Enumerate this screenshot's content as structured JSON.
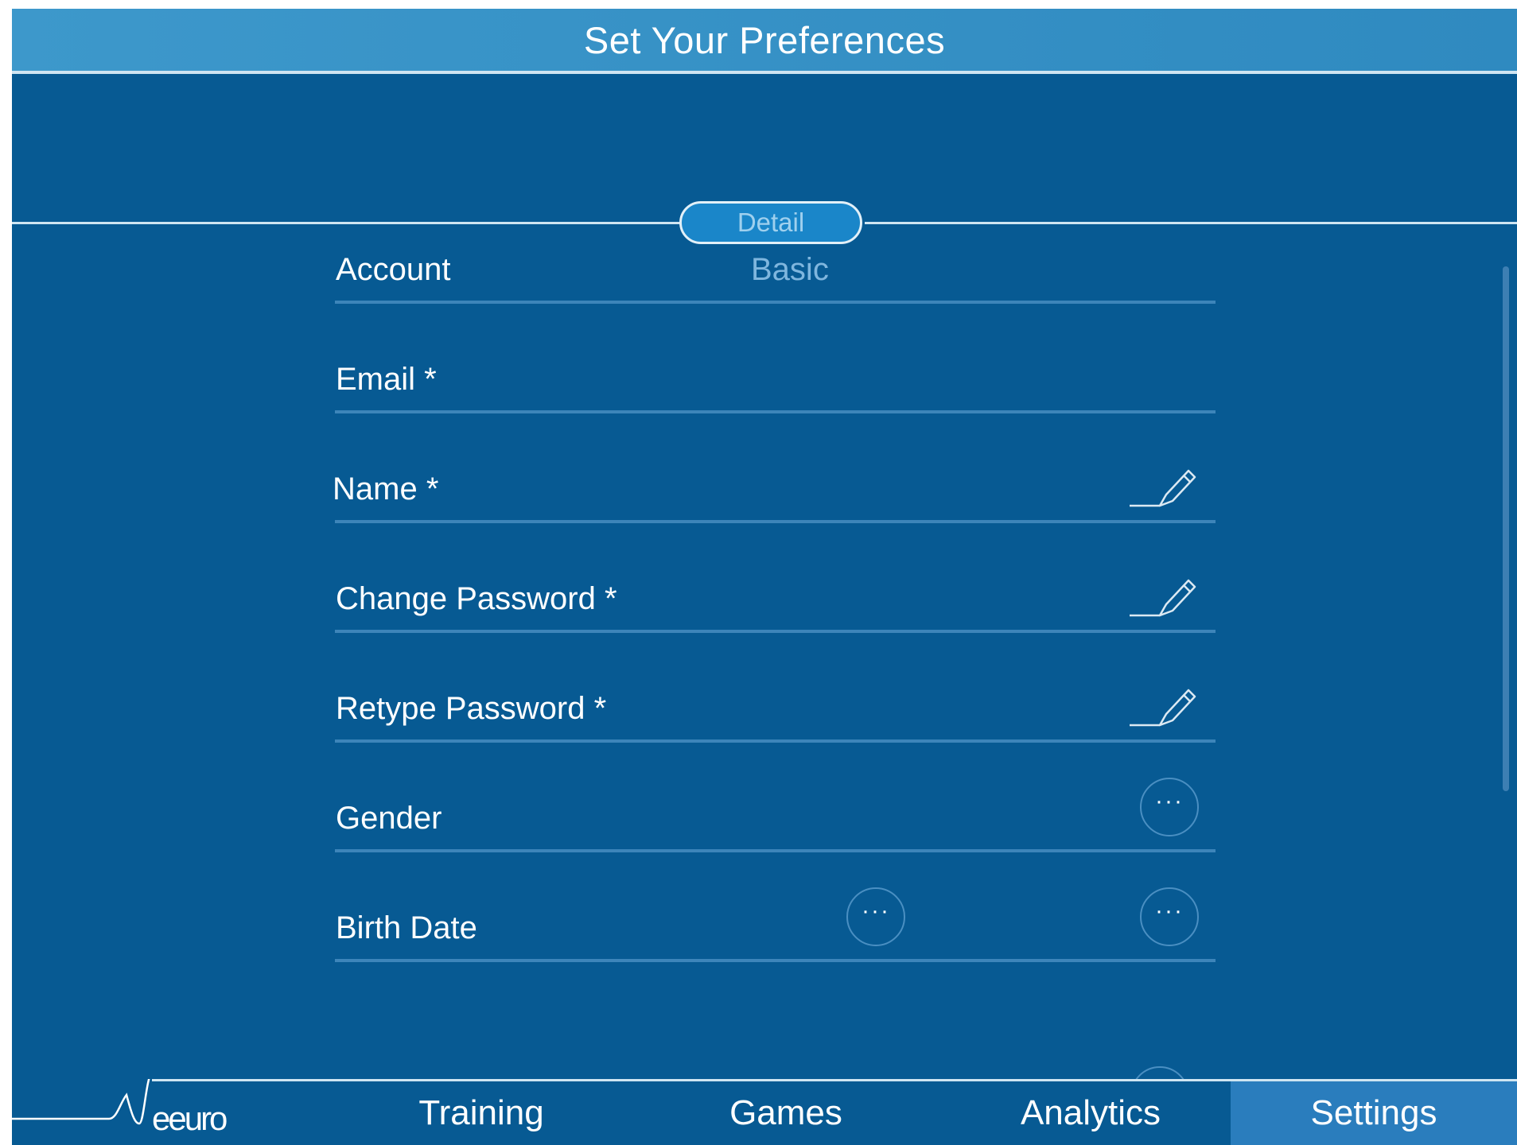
{
  "header": {
    "title": "Set Your Preferences"
  },
  "section": {
    "label": "Detail"
  },
  "form": {
    "account": {
      "label": "Account",
      "value": "Basic"
    },
    "email": {
      "label": "Email *"
    },
    "name": {
      "label": "Name *"
    },
    "change_password": {
      "label": "Change Password *"
    },
    "retype_password": {
      "label": "Retype Password *"
    },
    "gender": {
      "label": "Gender",
      "more": "···"
    },
    "birth_date": {
      "label": "Birth Date",
      "more": "···"
    }
  },
  "nav": {
    "logo": "eeuro",
    "items": [
      {
        "label": "Training"
      },
      {
        "label": "Games"
      },
      {
        "label": "Analytics"
      },
      {
        "label": "Settings",
        "active": true
      }
    ]
  },
  "colors": {
    "background": "#075a93",
    "title_bar": "#3d98cb",
    "active_tab": "#2a7dbd",
    "pill": "#1a86c9"
  },
  "icons": [
    "edit-pencil-icon",
    "more-options-icon",
    "neeuro-logo-icon"
  ]
}
